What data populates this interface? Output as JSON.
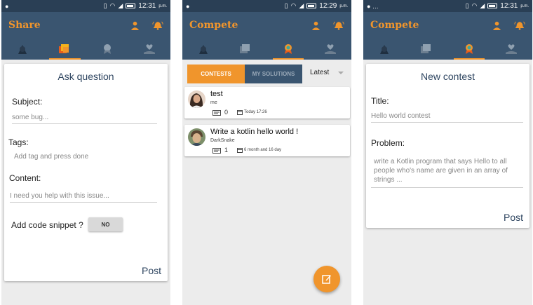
{
  "colors": {
    "accent": "#f0952c",
    "appbar": "#3a5570",
    "statusbar": "#2a3f55"
  },
  "screens": [
    {
      "status_time": "12:31",
      "status_ampm": "p.m.",
      "title": "Share"
    },
    {
      "status_time": "12:29",
      "status_ampm": "p.m.",
      "title": "Compete"
    },
    {
      "status_time": "12:31",
      "status_ampm": "p.m.",
      "title": "Compete"
    }
  ],
  "share": {
    "form_title": "Ask question",
    "subject_label": "Subject:",
    "subject_placeholder": "some bug...",
    "tags_label": "Tags:",
    "tags_placeholder": "Add tag and press done",
    "content_label": "Content:",
    "content_placeholder": "I need you help with this issue...",
    "snippet_label": "Add code snippet ?",
    "snippet_toggle": "NO",
    "post": "Post"
  },
  "compete": {
    "tab_contests": "CONTESTS",
    "tab_solutions": "MY SOLUTIONS",
    "sort_value": "Latest",
    "contests": [
      {
        "title": "test",
        "user": "me",
        "count": "0",
        "date": "Today 17:26"
      },
      {
        "title": "Write a kotlin hello world !",
        "user": "DarkSnake",
        "count": "1",
        "date": "6 month and 16 day"
      }
    ]
  },
  "new_contest": {
    "form_title": "New contest",
    "title_label": "Title:",
    "title_value": "Hello world contest",
    "problem_label": "Problem:",
    "problem_value": "write a Kotlin program that says Hello to all people who's name are given in an array of strings ...",
    "post": "Post"
  },
  "icons": {
    "statusbar": [
      "android-icon",
      "vibrate-icon",
      "wifi-icon",
      "signal-icon",
      "battery-icon"
    ],
    "appbar": [
      "profile-icon",
      "notifications-icon"
    ],
    "tabs": [
      "feed-icon",
      "share-icon",
      "compete-icon",
      "profile-tab-icon"
    ],
    "fab": "edit-icon"
  }
}
